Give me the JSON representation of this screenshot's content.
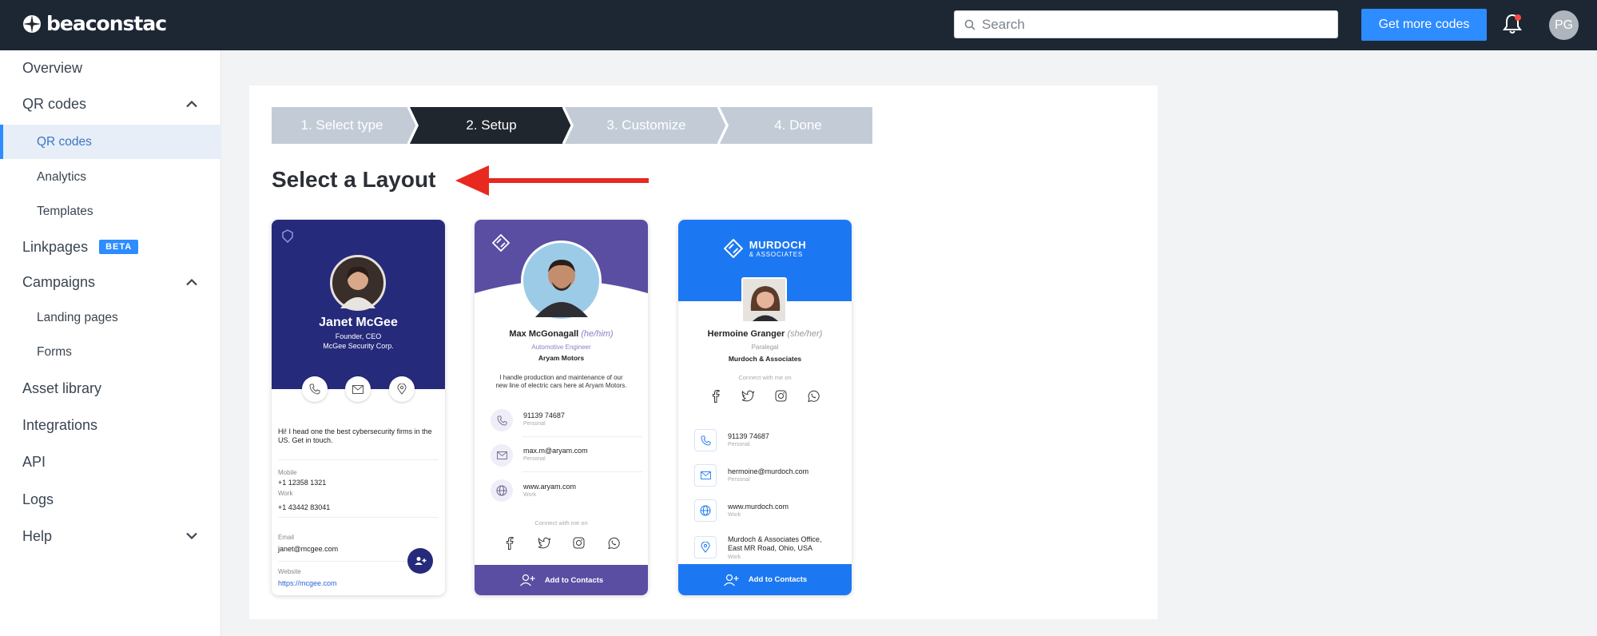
{
  "brand": {
    "name": "beaconstac"
  },
  "header": {
    "search_placeholder": "Search",
    "cta_label": "Get more codes",
    "avatar_initials": "PG"
  },
  "sidebar": {
    "items": [
      {
        "label": "Overview"
      },
      {
        "label": "QR codes"
      },
      {
        "label": "QR codes"
      },
      {
        "label": "Analytics"
      },
      {
        "label": "Templates"
      },
      {
        "label": "Linkpages",
        "badge": "BETA"
      },
      {
        "label": "Campaigns"
      },
      {
        "label": "Landing pages"
      },
      {
        "label": "Forms"
      },
      {
        "label": "Asset library"
      },
      {
        "label": "Integrations"
      },
      {
        "label": "API"
      },
      {
        "label": "Logs"
      },
      {
        "label": "Help"
      }
    ]
  },
  "stepper": {
    "steps": [
      "1. Select type",
      "2. Setup",
      "3. Customize",
      "4. Done"
    ],
    "active_index": 1
  },
  "main": {
    "title": "Select a Layout"
  },
  "colors": {
    "accent": "#2d8cff",
    "nav_bg": "#1d2734",
    "card1": "#262a7b",
    "card2": "#5a4ea3",
    "card3": "#1c78f2",
    "arrow": "#e8291f"
  },
  "cards": [
    {
      "name": "Janet McGee",
      "title": "Founder, CEO",
      "company": "McGee Security Corp.",
      "bio": "Hi! I head one the best cybersecurity firms in the US. Get in touch.",
      "mobile_label": "Mobile",
      "mobile": "+1 12358 1321",
      "work_label": "Work",
      "work": "+1 43442 83041",
      "email_label": "Email",
      "email": "janet@mcgee.com",
      "website_label": "Website",
      "website": "https://mcgee.com"
    },
    {
      "name": "Max McGonagall",
      "pronoun": "(he/him)",
      "title": "Automotive Engineer",
      "company": "Aryam Motors",
      "bio_line1": "I handle production and maintenance of our",
      "bio_line2": "new line of electric cars here at Aryam Motors.",
      "phone": "91139 74687",
      "phone_label": "Personal",
      "email": "max.m@aryam.com",
      "email_label": "Personal",
      "web": "www.aryam.com",
      "web_label": "Work",
      "connect": "Connect with me on",
      "cta": "Add to Contacts"
    },
    {
      "brand_line1": "MURDOCH",
      "brand_line2": "& ASSOCIATES",
      "name": "Hermoine Granger",
      "pronoun": "(she/her)",
      "title": "Paralegal",
      "company": "Murdoch & Associates",
      "connect": "Connect with me on",
      "phone": "91139 74687",
      "phone_label": "Personal",
      "email": "hermoine@murdoch.com",
      "email_label": "Personal",
      "web": "www.murdoch.com",
      "web_label": "Work",
      "addr_line1": "Murdoch & Associates Office,",
      "addr_line2": "East MR Road, Ohio, USA",
      "addr_label": "Work",
      "cta": "Add to Contacts"
    }
  ]
}
